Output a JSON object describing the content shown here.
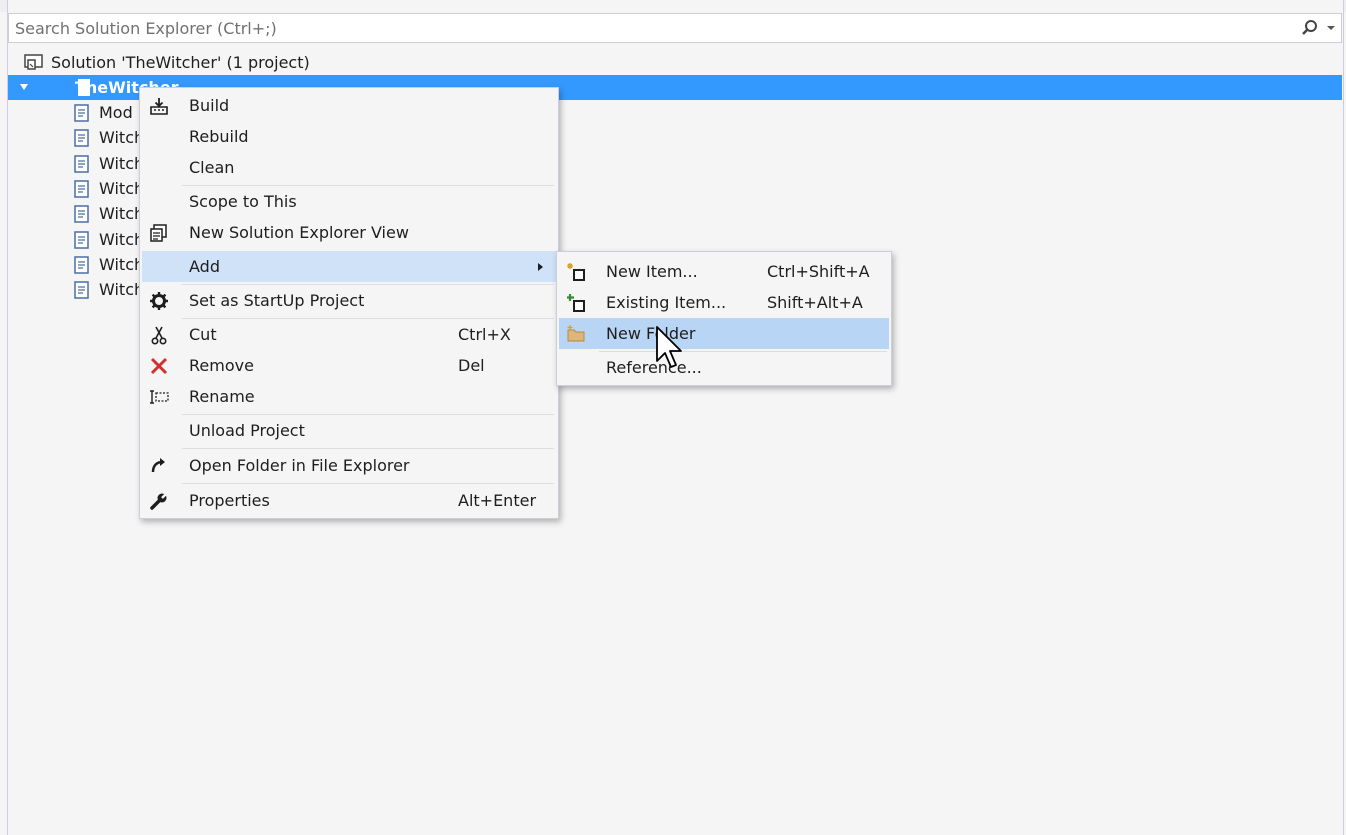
{
  "search": {
    "placeholder": "Search Solution Explorer (Ctrl+;)"
  },
  "tree": {
    "solution_label": "Solution 'TheWitcher' (1 project)",
    "project_label": "TheWitcher",
    "files": [
      "Mod",
      "Witch",
      "Witch",
      "Witch",
      "Witch",
      "Witch",
      "Witch",
      "Witch"
    ]
  },
  "context_menu": {
    "items": [
      {
        "label": "Build",
        "shortcut": "",
        "icon": "build-icon"
      },
      {
        "label": "Rebuild",
        "shortcut": ""
      },
      {
        "label": "Clean",
        "shortcut": ""
      },
      {
        "label": "Scope to This",
        "shortcut": ""
      },
      {
        "label": "New Solution Explorer View",
        "shortcut": "",
        "icon": "new-view-icon"
      },
      {
        "label": "Add",
        "shortcut": "",
        "has_submenu": true
      },
      {
        "label": "Set as StartUp Project",
        "shortcut": "",
        "icon": "gear-icon"
      },
      {
        "label": "Cut",
        "shortcut": "Ctrl+X",
        "icon": "scissors-icon"
      },
      {
        "label": "Remove",
        "shortcut": "Del",
        "icon": "remove-x-icon"
      },
      {
        "label": "Rename",
        "shortcut": "",
        "icon": "rename-icon"
      },
      {
        "label": "Unload Project",
        "shortcut": ""
      },
      {
        "label": "Open Folder in File Explorer",
        "shortcut": "",
        "icon": "open-folder-arrow-icon"
      },
      {
        "label": "Properties",
        "shortcut": "Alt+Enter",
        "icon": "wrench-icon"
      }
    ]
  },
  "add_submenu": {
    "items": [
      {
        "label": "New Item...",
        "shortcut": "Ctrl+Shift+A",
        "icon": "new-item-icon"
      },
      {
        "label": "Existing Item...",
        "shortcut": "Shift+Alt+A",
        "icon": "existing-item-icon"
      },
      {
        "label": "New Folder",
        "shortcut": "",
        "icon": "folder-icon"
      },
      {
        "label": "Reference...",
        "shortcut": ""
      }
    ]
  },
  "colors": {
    "selection": "#3399ff",
    "menu_highlight": "#cfe2f7",
    "menu_bg": "#f5f5f5",
    "remove_red": "#d0302e"
  }
}
